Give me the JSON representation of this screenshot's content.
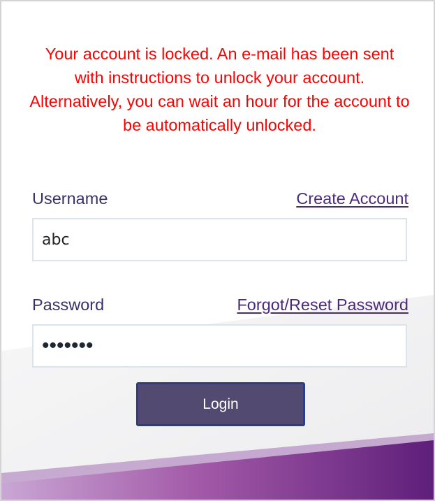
{
  "message": {
    "error": "Your account is locked. An e-mail has been sent with instructions to unlock your account. Alternatively, you can wait an hour for the account to be automatically unlocked."
  },
  "username": {
    "label": "Username",
    "link": "Create Account",
    "value": "abc"
  },
  "password": {
    "label": "Password",
    "link": "Forgot/Reset Password",
    "masked_value": "•••••••"
  },
  "login": {
    "label": "Login"
  },
  "colors": {
    "error": "#ff0000",
    "label": "#3a3266",
    "link": "#4b2a78",
    "button": "#524a70",
    "button_border": "#2a3d8a",
    "accent": "#7a2a8a"
  }
}
